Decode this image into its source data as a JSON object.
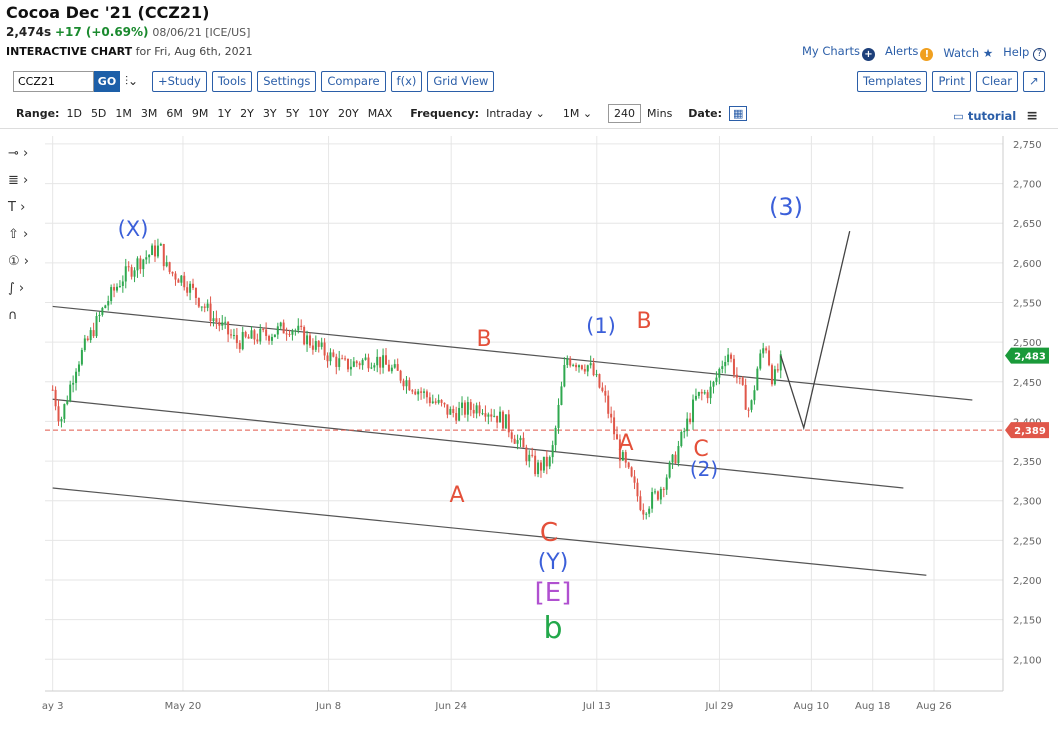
{
  "header": {
    "title": "Cocoa Dec '21 (CCZ21)",
    "price": "2,474s",
    "change": "+17 (+0.69%)",
    "meta": "08/06/21 [ICE/US]",
    "sub_bold": "INTERACTIVE CHART",
    "sub_rest": "for Fri, Aug 6th, 2021"
  },
  "top_links": {
    "my_charts": "My Charts",
    "alerts": "Alerts",
    "watch": "Watch",
    "help": "Help"
  },
  "toolbar": {
    "symbol": "CCZ21",
    "go": "GO",
    "study": "+Study",
    "tools": "Tools",
    "settings": "Settings",
    "compare": "Compare",
    "fx": "f(x)",
    "grid_view": "Grid View",
    "templates": "Templates",
    "print": "Print",
    "clear": "Clear"
  },
  "rangebar": {
    "range_label": "Range:",
    "ranges": [
      "1D",
      "5D",
      "1M",
      "3M",
      "6M",
      "9M",
      "1Y",
      "2Y",
      "3Y",
      "5Y",
      "10Y",
      "20Y",
      "MAX"
    ],
    "frequency_label": "Frequency:",
    "frequency": "Intraday",
    "interval": "1M",
    "minutes": "240",
    "minutes_unit": "Mins",
    "date_label": "Date:",
    "tutorial": "tutorial"
  },
  "chart_data": {
    "type": "candlestick",
    "title": "",
    "xlabel": "",
    "ylabel": "",
    "ylim": [
      2060,
      2760
    ],
    "y_ticks": [
      "2,750",
      "2,700",
      "2,650",
      "2,600",
      "2,550",
      "2,500",
      "2,450",
      "2,400",
      "2,350",
      "2,300",
      "2,250",
      "2,200",
      "2,150",
      "2,100"
    ],
    "x_ticks": [
      "ay 3",
      "May 20",
      "Jun 8",
      "Jun 24",
      "Jul 13",
      "Jul 29",
      "Aug 10",
      "Aug 18",
      "Aug 26"
    ],
    "last_price_label": "2,483",
    "ref_price_label": "2,389",
    "ref_price": 2389,
    "last_price": 2483,
    "price_path": [
      [
        "May 3",
        2440
      ],
      [
        "May 4",
        2400
      ],
      [
        "May 6",
        2470
      ],
      [
        "May 10",
        2550
      ],
      [
        "May 12",
        2580
      ],
      [
        "May 14",
        2600
      ],
      [
        "May 17",
        2620
      ],
      [
        "May 18",
        2590
      ],
      [
        "May 20",
        2580
      ],
      [
        "May 24",
        2530
      ],
      [
        "May 27",
        2500
      ],
      [
        "May 31",
        2510
      ],
      [
        "Jun 3",
        2520
      ],
      [
        "Jun 7",
        2490
      ],
      [
        "Jun 10",
        2470
      ],
      [
        "Jun 14",
        2480
      ],
      [
        "Jun 17",
        2460
      ],
      [
        "Jun 21",
        2430
      ],
      [
        "Jun 24",
        2410
      ],
      [
        "Jun 28",
        2420
      ],
      [
        "Jul 1",
        2400
      ],
      [
        "Jul 5",
        2340
      ],
      [
        "Jul 7",
        2350
      ],
      [
        "Jul 9",
        2480
      ],
      [
        "Jul 12",
        2470
      ],
      [
        "Jul 14",
        2430
      ],
      [
        "Jul 16",
        2360
      ],
      [
        "Jul 19",
        2290
      ],
      [
        "Jul 21",
        2310
      ],
      [
        "Jul 23",
        2350
      ],
      [
        "Jul 26",
        2430
      ],
      [
        "Jul 28",
        2440
      ],
      [
        "Jul 30",
        2490
      ],
      [
        "Aug 2",
        2410
      ],
      [
        "Aug 3",
        2470
      ],
      [
        "Aug 4",
        2500
      ],
      [
        "Aug 5",
        2450
      ],
      [
        "Aug 6",
        2474
      ]
    ],
    "projection": [
      [
        "Aug 6",
        2483
      ],
      [
        "Aug 9",
        2392
      ],
      [
        "Aug 15",
        2640
      ]
    ],
    "channel_lines": [
      {
        "from": [
          "May 3",
          2545
        ],
        "to": [
          "Aug 31",
          2427
        ]
      },
      {
        "from": [
          "May 3",
          2428
        ],
        "to": [
          "Aug 22",
          2316
        ]
      },
      {
        "from": [
          "May 3",
          2316
        ],
        "to": [
          "Aug 25",
          2206
        ]
      }
    ],
    "wave_labels": [
      {
        "text": "(X)",
        "color": "#3b5fd9"
      },
      {
        "text": "A",
        "color": "#e4503a"
      },
      {
        "text": "B",
        "color": "#e4503a"
      },
      {
        "text": "C",
        "color": "#e4503a"
      },
      {
        "text": "(Y)",
        "color": "#3b5fd9"
      },
      {
        "text": "[E]",
        "color": "#b050d0"
      },
      {
        "text": "b",
        "color": "#22a84a"
      },
      {
        "text": "(1)",
        "color": "#3b5fd9"
      },
      {
        "text": "A",
        "color": "#e4503a"
      },
      {
        "text": "B",
        "color": "#e4503a"
      },
      {
        "text": "C",
        "color": "#e4503a"
      },
      {
        "text": "(2)",
        "color": "#3b5fd9"
      },
      {
        "text": "(3)",
        "color": "#3b5fd9"
      }
    ],
    "colors": {
      "up": "#2fa84f",
      "down": "#e0574a",
      "ref": "#e0574a",
      "last": "#1a9a3a",
      "line": "#555555"
    }
  }
}
